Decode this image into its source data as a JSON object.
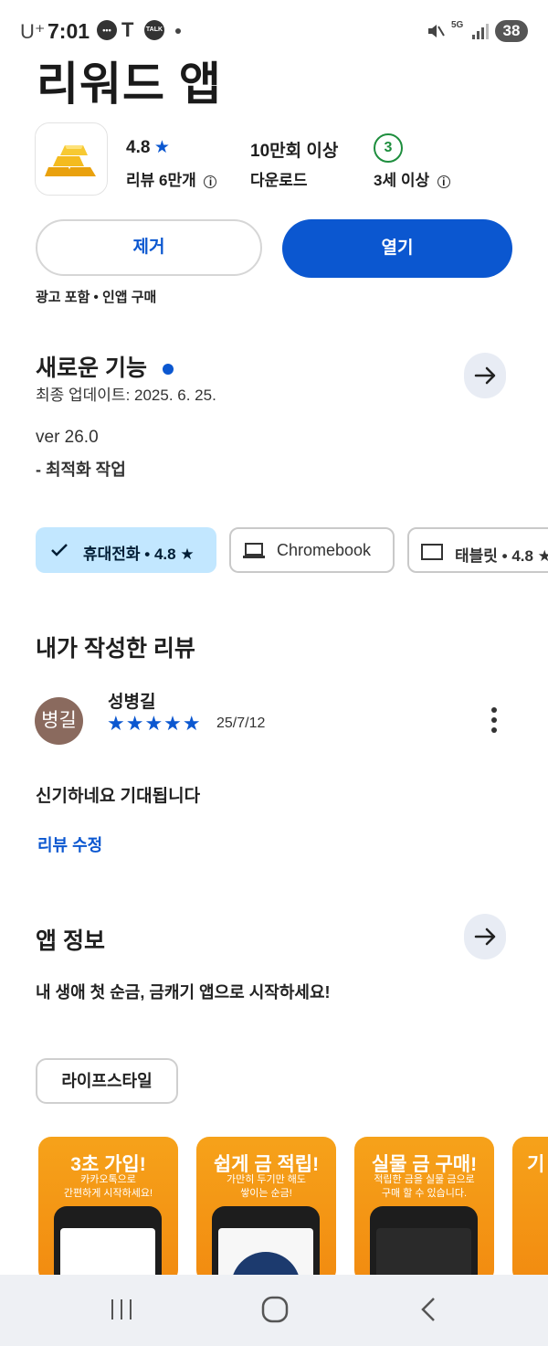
{
  "status_bar": {
    "carrier": "U⁺",
    "time": "7:01",
    "notif_talk": "TALK",
    "network": "5G",
    "battery": "38"
  },
  "app": {
    "title": "리워드 앱",
    "rating": "4.8",
    "reviews": "리뷰 6만개",
    "downloads": "10만회 이상",
    "downloads_label": "다운로드",
    "age_badge": "3",
    "age_label": "3세 이상"
  },
  "actions": {
    "uninstall": "제거",
    "open": "열기",
    "ads_note": "광고 포함 • 인앱 구매"
  },
  "whats_new": {
    "title": "새로운 기능",
    "updated": "최종 업데이트: 2025. 6. 25.",
    "version": "ver 26.0",
    "note": "- 최적화 작업"
  },
  "device_chips": {
    "phone": "휴대전화 • 4.8 ★",
    "chromebook": "Chromebook",
    "tablet": "태블릿 • 4.8 ★"
  },
  "my_review": {
    "title": "내가 작성한 리뷰",
    "avatar": "병길",
    "author": "성병길",
    "stars": "★★★★★",
    "date": "25/7/12",
    "text": "신기하네요 기대됩니다",
    "edit": "리뷰 수정"
  },
  "about": {
    "title": "앱 정보",
    "tagline": "내 생애 첫 순금, 금캐기 앱으로 시작하세요!",
    "category": "라이프스타일"
  },
  "screenshots": [
    {
      "title": "3초 가입!",
      "sub": "카카오톡으로\n간편하게 시작하세요!"
    },
    {
      "title": "쉽게 금 적립!",
      "sub": "가만히 두기만 해도\n쌓이는 순금!"
    },
    {
      "title": "실물 금 구매!",
      "sub": "적립한 금을 실물 금으로\n구매 할 수 있습니다."
    },
    {
      "title": "기",
      "sub": ""
    }
  ],
  "colors": {
    "accent": "#0b57d0",
    "chip_selected": "#c2e7ff",
    "age_green": "#1e8e3e"
  }
}
